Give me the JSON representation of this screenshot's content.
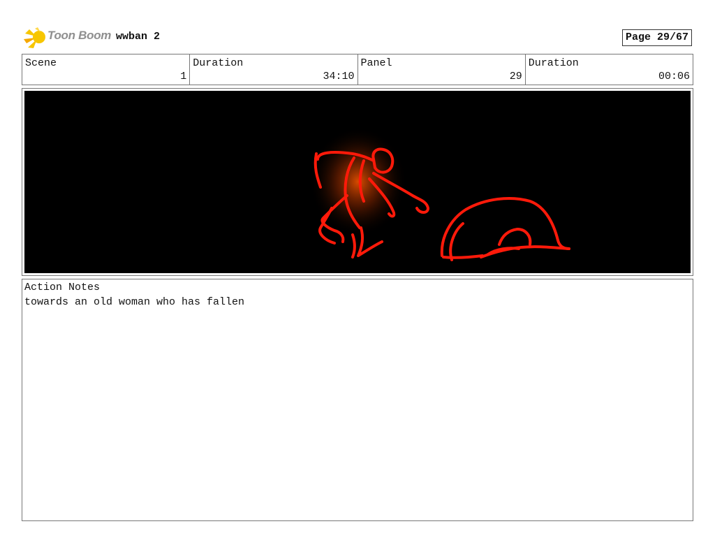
{
  "header": {
    "logo_text": "Toon Boom",
    "title": "wwban 2",
    "page": "Page 29/67"
  },
  "info": {
    "scene_label": "Scene",
    "scene_value": "1",
    "duration_label": "Duration",
    "duration_value": "34:10",
    "panel_label": "Panel",
    "panel_value": "29",
    "panel_duration_label": "Duration",
    "panel_duration_value": "00:06"
  },
  "panel": {
    "background": "#000000",
    "sketch_color": "#ff1a0a",
    "glow_color": "#ff5a00"
  },
  "notes": {
    "label": "Action Notes",
    "text": "towards an old woman who has fallen"
  }
}
